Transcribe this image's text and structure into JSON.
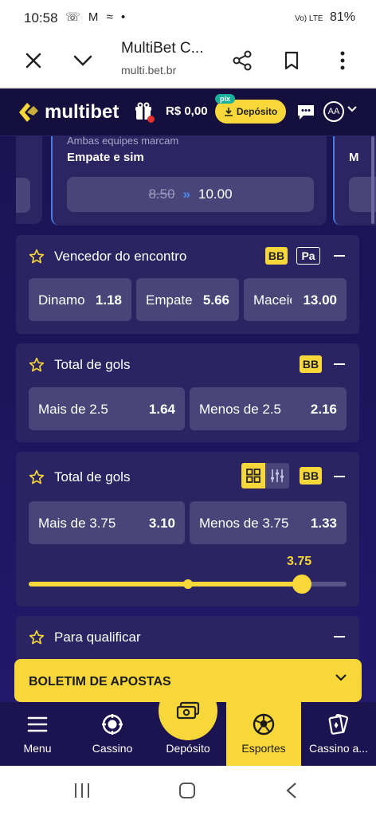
{
  "status_bar": {
    "time": "10:58",
    "notif_icons": "☏ M ≈ •",
    "battery": "81%",
    "network": "Vo) LTE"
  },
  "browser": {
    "title": "MultiBet C...",
    "url": "multi.bet.br"
  },
  "header": {
    "brand": "multibet",
    "balance": "R$ 0,00",
    "deposit_label": "Depósito",
    "pix_label": "pix",
    "avatar_initials": "AA"
  },
  "carousel": {
    "cut_text": "Ambas equipes marcam",
    "main_label": "Empate e sim",
    "old_odd": "8.50",
    "new_odd": "10.00",
    "right_label": "M"
  },
  "markets": [
    {
      "title": "Vencedor do encontro",
      "badges": [
        "BB",
        "Pa"
      ],
      "outcomes": [
        {
          "name": "Dinamo",
          "odd": "1.18"
        },
        {
          "name": "Empate",
          "odd": "5.66"
        },
        {
          "name": "Maceió",
          "odd": "13.00"
        }
      ]
    },
    {
      "title": "Total de gols",
      "badges": [
        "BB"
      ],
      "outcomes": [
        {
          "name": "Mais de 2.5",
          "odd": "1.64"
        },
        {
          "name": "Menos de 2.5",
          "odd": "2.16"
        }
      ]
    },
    {
      "title": "Total de gols",
      "badges": [
        "BB"
      ],
      "outcomes": [
        {
          "name": "Mais de 3.75",
          "odd": "3.10"
        },
        {
          "name": "Menos de 3.75",
          "odd": "1.33"
        }
      ],
      "slider": {
        "value_label": "3.75",
        "fill_fraction": 0.86,
        "mid_fraction": 0.5
      }
    },
    {
      "title": "Para qualificar",
      "badges": []
    }
  ],
  "betslip": {
    "label": "BOLETIM DE APOSTAS"
  },
  "nav": {
    "menu": "Menu",
    "cassino": "Cassino",
    "deposito": "Depósito",
    "esportes": "Esportes",
    "cassino_ao_vivo": "Cassino a..."
  },
  "colors": {
    "accent": "#f8d73a",
    "panel": "#2a2462",
    "bg": "#1e1660",
    "button": "#4a4578"
  },
  "icons": [
    "close-icon",
    "chevron-down-icon",
    "share-icon",
    "bookmark-icon",
    "more-vert-icon",
    "gift-icon",
    "chat-icon",
    "star-icon",
    "grid-icon",
    "sliders-icon",
    "hamburger-icon",
    "casino-chip-icon",
    "money-icon",
    "soccer-ball-icon",
    "cards-icon"
  ]
}
